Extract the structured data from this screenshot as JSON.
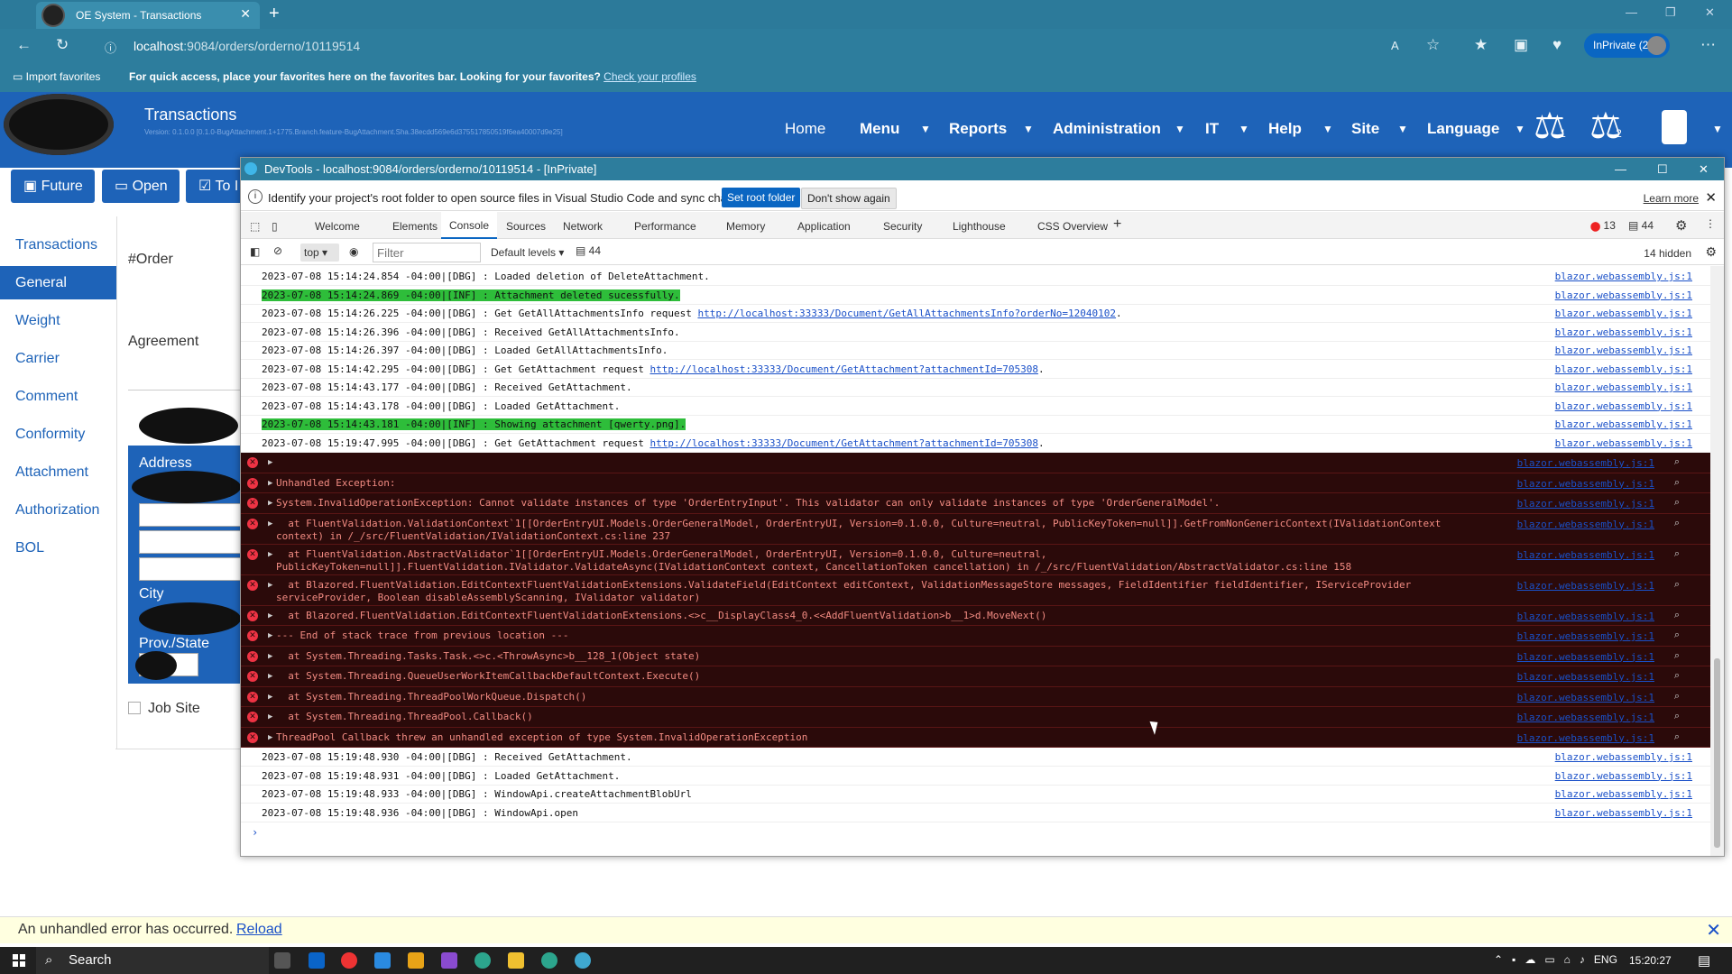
{
  "browser": {
    "tab_title": "OE System - Transactions",
    "url_host": "localhost",
    "url_rest": ":9084/orders/orderno/10119514",
    "inprivate_label": "InPrivate (2)",
    "fav_import": "Import favorites",
    "fav_message": "For quick access, place your favorites here on the favorites bar. Looking for your favorites?",
    "fav_link": "Check your profiles"
  },
  "app": {
    "title": "Transactions",
    "version": "Version: 0.1.0.0 [0.1.0-BugAttachment.1+1775.Branch.feature-BugAttachment.Sha.38ecdd569e6d375517850519f6ea40007d9e25]",
    "nav": [
      "Home",
      "Menu",
      "Reports",
      "Administration",
      "IT",
      "Help",
      "Site",
      "Language"
    ],
    "scale1": "1",
    "scale2": "2",
    "buttons": [
      "Future",
      "Open",
      "To I"
    ],
    "sidebar": [
      "Transactions",
      "General",
      "Weight",
      "Carrier",
      "Comment",
      "Conformity",
      "Attachment",
      "Authorization",
      "BOL"
    ],
    "labels": {
      "order": "#Order",
      "agreement": "Agreement",
      "address": "Address",
      "city": "City",
      "prov": "Prov./State",
      "jobsite": "Job Site"
    }
  },
  "devtools": {
    "title": "DevTools - localhost:9084/orders/orderno/10119514 - [InPrivate]",
    "info": "Identify your project's root folder to open source files in Visual Studio Code and sync changes.",
    "set_root": "Set root folder",
    "dont_show": "Don't show again",
    "learn_more": "Learn more",
    "tabs": [
      "Welcome",
      "Elements",
      "Console",
      "Sources",
      "Network",
      "Performance",
      "Memory",
      "Application",
      "Security",
      "Lighthouse",
      "CSS Overview"
    ],
    "error_count": "13",
    "message_count": "44",
    "context": "top",
    "filter_placeholder": "Filter",
    "levels": "Default levels",
    "hidden": "14 hidden",
    "source": "blazor.webassembly.js:1",
    "logs_a": [
      {
        "t": "2023-07-08 15:14:24.854 -04:00|[DBG] : Loaded deletion of DeleteAttachment.",
        "k": "dbg"
      },
      {
        "t": "2023-07-08 15:14:24.869 -04:00|[INF] : Attachment deleted sucessfully.",
        "k": "inf"
      },
      {
        "t": "2023-07-08 15:14:26.225 -04:00|[DBG] : Get GetAllAttachmentsInfo request ",
        "link": "http://localhost:33333/Document/GetAllAttachmentsInfo?orderNo=12040102",
        "k": "dbg"
      },
      {
        "t": "2023-07-08 15:14:26.396 -04:00|[DBG] : Received GetAllAttachmentsInfo.",
        "k": "dbg"
      },
      {
        "t": "2023-07-08 15:14:26.397 -04:00|[DBG] : Loaded GetAllAttachmentsInfo.",
        "k": "dbg"
      },
      {
        "t": "2023-07-08 15:14:42.295 -04:00|[DBG] : Get GetAttachment request ",
        "link": "http://localhost:33333/Document/GetAttachment?attachmentId=705308",
        "k": "dbg"
      },
      {
        "t": "2023-07-08 15:14:43.177 -04:00|[DBG] : Received GetAttachment.",
        "k": "dbg"
      },
      {
        "t": "2023-07-08 15:14:43.178 -04:00|[DBG] : Loaded GetAttachment.",
        "k": "dbg"
      },
      {
        "t": "2023-07-08 15:14:43.181 -04:00|[INF] : Showing attachment [qwerty.png].",
        "k": "inf"
      },
      {
        "t": "2023-07-08 15:19:47.995 -04:00|[DBG] : Get GetAttachment request ",
        "link": "http://localhost:33333/Document/GetAttachment?attachmentId=705308",
        "k": "dbg"
      }
    ],
    "errors": [
      "",
      "Unhandled Exception:",
      "System.InvalidOperationException: Cannot validate instances of type 'OrderEntryInput'. This validator can only validate instances of type 'OrderGeneralModel'.",
      "  at FluentValidation.ValidationContext`1[[OrderEntryUI.Models.OrderGeneralModel, OrderEntryUI, Version=0.1.0.0, Culture=neutral, PublicKeyToken=null]].GetFromNonGenericContext(IValidationContext context) in /_/src/FluentValidation/IValidationContext.cs:line 237",
      "  at FluentValidation.AbstractValidator`1[[OrderEntryUI.Models.OrderGeneralModel, OrderEntryUI, Version=0.1.0.0, Culture=neutral, PublicKeyToken=null]].FluentValidation.IValidator.ValidateAsync(IValidationContext context, CancellationToken cancellation) in /_/src/FluentValidation/AbstractValidator.cs:line 158",
      "  at Blazored.FluentValidation.EditContextFluentValidationExtensions.ValidateField(EditContext editContext, ValidationMessageStore messages, FieldIdentifier fieldIdentifier, IServiceProvider serviceProvider, Boolean disableAssemblyScanning, IValidator validator)",
      "  at Blazored.FluentValidation.EditContextFluentValidationExtensions.<>c__DisplayClass4_0.<<AddFluentValidation>b__1>d.MoveNext()",
      "--- End of stack trace from previous location ---",
      "  at System.Threading.Tasks.Task.<>c.<ThrowAsync>b__128_1(Object state)",
      "  at System.Threading.QueueUserWorkItemCallbackDefaultContext.Execute()",
      "  at System.Threading.ThreadPoolWorkQueue.Dispatch()",
      "  at System.Threading.ThreadPool.Callback()",
      "ThreadPool Callback threw an unhandled exception of type System.InvalidOperationException"
    ],
    "logs_b": [
      "2023-07-08 15:19:48.930 -04:00|[DBG] : Received GetAttachment.",
      "2023-07-08 15:19:48.931 -04:00|[DBG] : Loaded GetAttachment.",
      "2023-07-08 15:19:48.933 -04:00|[DBG] : WindowApi.createAttachmentBlobUrl",
      "2023-07-08 15:19:48.936 -04:00|[DBG] : WindowApi.open"
    ]
  },
  "error_bar": {
    "text": "An unhandled error has occurred.",
    "reload": "Reload"
  },
  "taskbar": {
    "search": "Search",
    "lang": "ENG",
    "time": "15:20:27"
  }
}
